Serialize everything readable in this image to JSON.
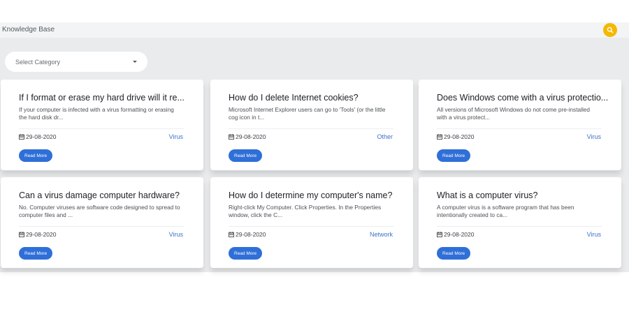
{
  "header": {
    "title": "Knowledge Base",
    "search_icon": "search-icon"
  },
  "filter": {
    "select_label": "Select Category"
  },
  "colors": {
    "accent": "#2f6fd8",
    "search_button": "#f5b800",
    "category_link": "#3b72c9"
  },
  "cards": [
    {
      "title": "If I format or erase my hard drive will it re...",
      "excerpt": "If your computer is infected with a virus formatting or erasing the hard disk dr...",
      "date": "29-08-2020",
      "category": "Virus",
      "button": "Read More"
    },
    {
      "title": "How do I delete Internet cookies?",
      "excerpt": "Microsoft Internet Explorer users can go to 'Tools' (or the little cog icon in t...",
      "date": "29-08-2020",
      "category": "Other",
      "button": "Read More"
    },
    {
      "title": "Does Windows come with a virus protectio...",
      "excerpt": "All versions of Microsoft Windows do not come pre-installed with a virus protect...",
      "date": "29-08-2020",
      "category": "Virus",
      "button": "Read More"
    },
    {
      "title": "Can a virus damage computer hardware?",
      "excerpt": "No. Computer viruses are software code designed to spread to computer files and ...",
      "date": "29-08-2020",
      "category": "Virus",
      "button": "Read More"
    },
    {
      "title": "How do I determine my computer's name?",
      "excerpt": "Right-click My Computer. Click Properties. In the Properties window, click the C...",
      "date": "29-08-2020",
      "category": "Network",
      "button": "Read More"
    },
    {
      "title": "What is a computer virus?",
      "excerpt": "A computer virus is a software program that has been intentionally created to ca...",
      "date": "29-08-2020",
      "category": "Virus",
      "button": "Read More"
    }
  ]
}
